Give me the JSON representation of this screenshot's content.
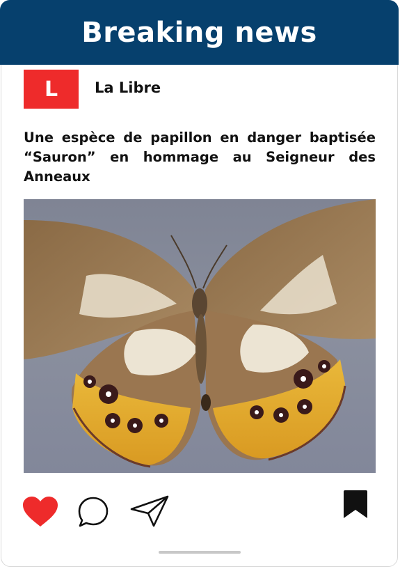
{
  "header": {
    "title": "Breaking news"
  },
  "source": {
    "logo_letter": "L",
    "name": "La Libre"
  },
  "post": {
    "headline": "Une espèce de papillon en danger  baptisée “Sauron” en hommage au Seigneur des Anneaux",
    "image_subject": "butterfly-photo"
  },
  "actions": {
    "icons": [
      "heart-icon",
      "comment-icon",
      "share-icon",
      "bookmark-icon"
    ],
    "like_color": "#ee2b2b"
  },
  "colors": {
    "header_bg": "#06406d",
    "logo_bg": "#ee2b2b",
    "text": "#111111"
  }
}
